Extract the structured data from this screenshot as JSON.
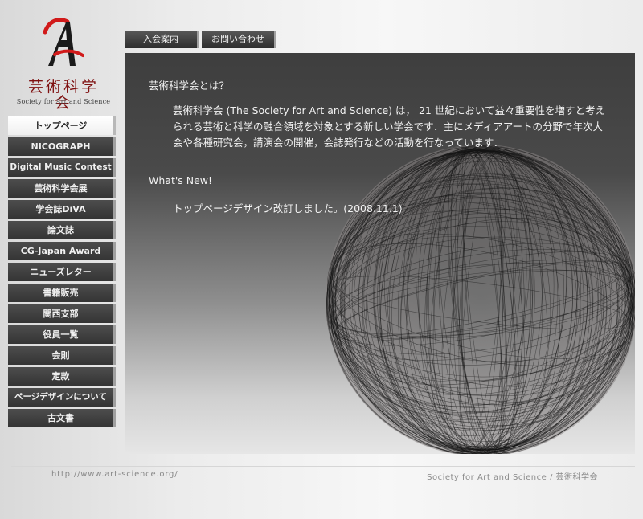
{
  "logo": {
    "mark_letter": "A",
    "name_jp": "芸術科学会",
    "name_en": "Society for Art and Science"
  },
  "tabs": [
    "入会案内",
    "お問い合わせ"
  ],
  "sidebar": {
    "active_index": 0,
    "items": [
      "トップページ",
      "NICOGRAPH",
      "Digital Music Contest",
      "芸術科学会展",
      "学会誌DiVA",
      "論文誌",
      "CG-Japan Award",
      "ニューズレター",
      "書籍販売",
      "関西支部",
      "役員一覧",
      "会則",
      "定款",
      "ページデザインについて",
      "古文書"
    ]
  },
  "main": {
    "about_heading": "芸術科学会とは？",
    "about_text": "芸術科学会 (The Society for Art and Science) は， 21 世紀において益々重要性を増すと考えられる芸術と科学の融合領域を対象とする新しい学会です．主にメディアアートの分野で年次大会や各種研究会，講演会の開催，会誌発行などの活動を行なっています．",
    "news_heading": "What's New!",
    "news_item": "トップページデザイン改訂しました。(2008.11.1)"
  },
  "footer": {
    "url": "http://www.art-science.org/",
    "name": "Society for Art and Science / 芸術科学会"
  },
  "colors": {
    "logo_red": "#d11a1a",
    "logo_dark": "#1a1a1a",
    "logo_text": "#7f1010",
    "nav_bg": "#3a3a3a",
    "nav_active_bg": "#ffffff",
    "content_top": "#3e3e3e",
    "content_bottom": "#e6e6e6"
  }
}
